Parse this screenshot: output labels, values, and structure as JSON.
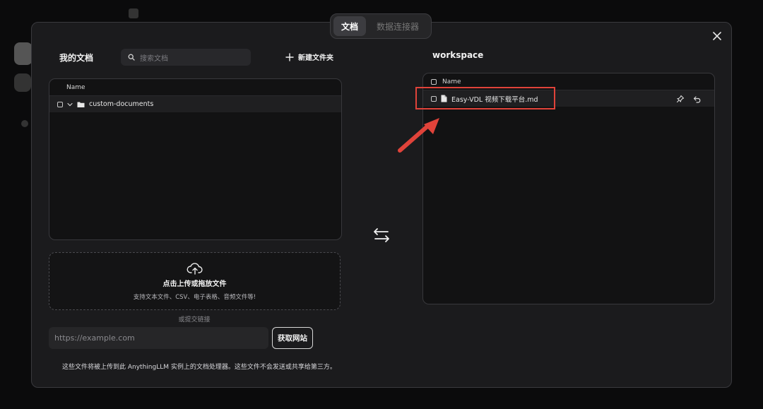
{
  "tabs": [
    {
      "label": "文档",
      "active": true
    },
    {
      "label": "数据连接器",
      "active": false
    }
  ],
  "left_panel": {
    "title": "我的文档",
    "search_placeholder": "搜索文档",
    "new_folder_label": "新建文件夹",
    "column_header": "Name",
    "rows": [
      {
        "name": "custom-documents",
        "type": "folder"
      }
    ]
  },
  "upload": {
    "title": "点击上传或拖放文件",
    "subtitle": "支持文本文件、CSV、电子表格、音频文件等!",
    "or_link": "或提交链接",
    "url_placeholder": "https://example.com",
    "fetch_label": "获取网站",
    "footnote": "这些文件将被上传到此 AnythingLLM 实例上的文档处理器。这些文件不会发送或共享给第三方。"
  },
  "right_panel": {
    "title": "workspace",
    "column_header": "Name",
    "rows": [
      {
        "name": "Easy-VDL 视频下载平台.md",
        "type": "file"
      }
    ]
  },
  "colors": {
    "modal_bg": "#1b1b1d",
    "panel_bg": "#121213",
    "highlight": "#e0433a"
  },
  "icons": [
    "close-icon",
    "search-icon",
    "plus-icon",
    "chevron-down-icon",
    "folder-icon",
    "upload-cloud-icon",
    "swap-arrows-icon",
    "file-icon",
    "pin-icon",
    "undo-icon"
  ]
}
